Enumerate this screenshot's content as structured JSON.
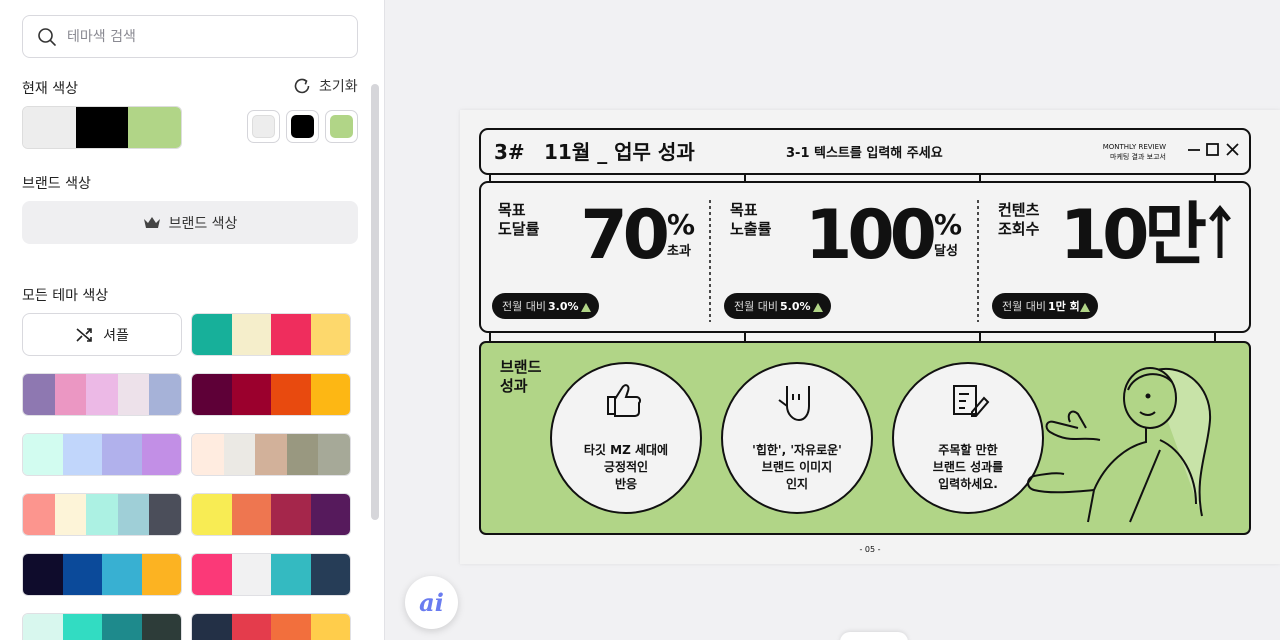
{
  "sidebar": {
    "search": {
      "placeholder": "테마색 검색"
    },
    "current": {
      "title": "현재 색상",
      "reset_label": "초기화",
      "colors": [
        "#ededed",
        "#000000",
        "#b1d587"
      ]
    },
    "brand": {
      "title": "브랜드 색상",
      "button_label": "브랜드 색상"
    },
    "all": {
      "title": "모든 테마 색상",
      "shuffle_label": "셔플",
      "palettes": [
        [
          "#17b09a",
          "#f5eecb",
          "#ef2d5d",
          "#fdd86c"
        ],
        [
          "#8e78b1",
          "#eb97c3",
          "#ecb9e6",
          "#ede1ea",
          "#a6b2d8"
        ],
        [
          "#5e0037",
          "#9b002d",
          "#e84a0f",
          "#fdb714"
        ],
        [
          "#d2fcf0",
          "#c1d6fb",
          "#b1b1ec",
          "#c28fe6"
        ],
        [
          "#ffece0",
          "#ebe9e4",
          "#d2b19a",
          "#999880",
          "#a6a998"
        ],
        [
          "#fc958e",
          "#fdf4d8",
          "#acf1e3",
          "#9fcfd7",
          "#4b4e5a"
        ],
        [
          "#f8ec54",
          "#ee7650",
          "#a5264b",
          "#561a5c"
        ],
        [
          "#0f0c2c",
          "#0b4a9a",
          "#38b0d2",
          "#fcb322"
        ],
        [
          "#fb3978",
          "#f1f1f2",
          "#34bac1",
          "#263d57"
        ],
        [
          "#d8f7ee",
          "#32dcc2",
          "#1e8a8c",
          "#2d3c39"
        ],
        [
          "#233046",
          "#e43c4c",
          "#f26f3d",
          "#ffcd4b"
        ]
      ]
    }
  },
  "slide": {
    "number": "3#",
    "title": "11월 _ 업무 성과",
    "subtitle": "3-1  텍스트를 입력해 주세요",
    "review_en": "MONTHLY REVIEW",
    "review_ko": "마케팅 결과 보고서",
    "stats": [
      {
        "label1": "목표",
        "label2": "도달률",
        "value": "70",
        "unit": "%",
        "suffix": "초과",
        "badge_prefix": "전월 대비",
        "badge_value": "3.0%"
      },
      {
        "label1": "목표",
        "label2": "노출률",
        "value": "100",
        "unit": "%",
        "suffix": "달성",
        "badge_prefix": "전월 대비",
        "badge_value": "5.0%"
      },
      {
        "label1": "컨텐츠",
        "label2": "조회수",
        "value": "10만",
        "unit": "",
        "suffix": "",
        "badge_prefix": "전월 대비",
        "badge_value": "1만 회"
      }
    ],
    "brand_title1": "브랜드",
    "brand_title2": "성과",
    "circles": [
      {
        "l1": "타깃 MZ 세대에",
        "l2": "긍정적인",
        "l3": "반응"
      },
      {
        "l1": "'힙한', '자유로운'",
        "l2": "브랜드 이미지",
        "l3": "인지"
      },
      {
        "l1": "주목할 만한",
        "l2": "브랜드 성과를",
        "l3": "입력하세요."
      }
    ],
    "page": "- 05 -"
  },
  "ai_button": {
    "label": "ai"
  },
  "colors": {
    "accent_green": "#b1d587",
    "dark": "#111111"
  }
}
